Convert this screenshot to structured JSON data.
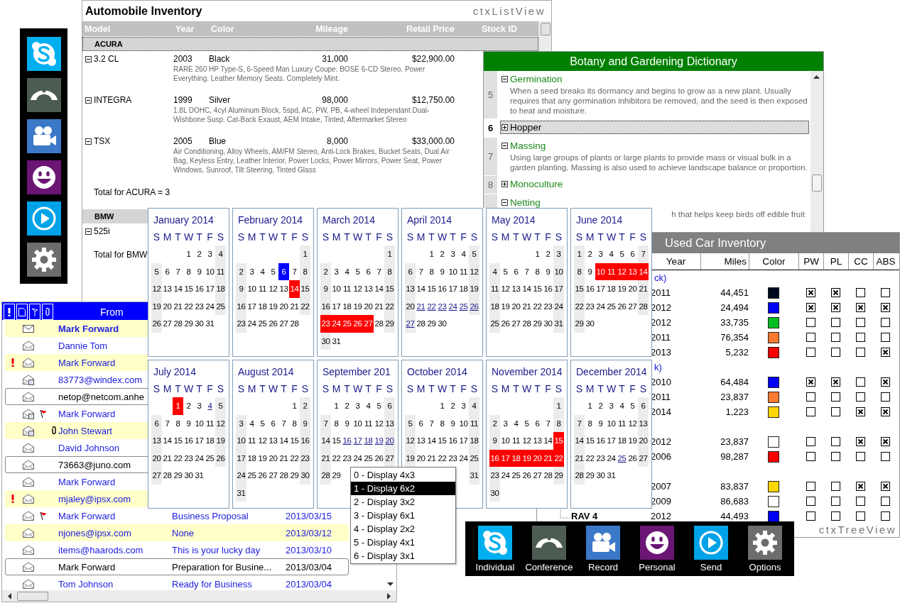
{
  "inventory": {
    "title": "Automobile Inventory",
    "brand": "ctxListView",
    "columns": [
      "Model",
      "Year",
      "Color",
      "Mileage",
      "Retail Price",
      "Stock ID"
    ],
    "groups": [
      {
        "name": "ACURA",
        "selected": true,
        "cars": [
          {
            "model": "3.2 CL",
            "expanded": true,
            "year": "2003",
            "exterior": "Black",
            "mileage": "31,000",
            "price": "$22,900.00",
            "notes": "RARE 260 HP Type-S, 6-Speed Man Luxury Coupe. BOSE 6-CD Stereo. Power Everything. Leather Memory Seats. Completely Mint."
          },
          {
            "model": "INTEGRA",
            "expanded": true,
            "year": "1999",
            "exterior": "Silver",
            "mileage": "98,000",
            "price": "$12,750.00",
            "notes": "1.8L DOHC, 4cyl Aluminum Block, 5spd, AC, PW, PB, 4-wheel Independant Dual-Wishbone Susp. Cat-Back Exaust, AEM Intake, Tinted, Aftermarket Stereo"
          },
          {
            "model": "TSX",
            "expanded": true,
            "year": "2005",
            "exterior": "Blue",
            "mileage": "8,000",
            "price": "$33,000.00",
            "notes": "Air Conditioning, Alloy Wheels, AM/FM Stereo, Anti-Lock Brakes, Bucket Seats, Dual Air Bag, Keyless Entry, Leather Interior, Power Locks, Power Mirrors, Power Seat, Power Windows, Sunroof, Tilt Steering, Tinted Glass"
          }
        ],
        "total": "Total for ACURA = 3"
      },
      {
        "name": "BMW",
        "selected": false,
        "cars": [
          {
            "model": "525i",
            "expanded": true
          }
        ],
        "total": "Total for BMW"
      }
    ]
  },
  "botany": {
    "title": "Botany and Gardening Dictionary",
    "entries": [
      {
        "number": "5",
        "expanded": true,
        "selected": false,
        "term": "Germination",
        "definition": "When a seed breaks its dormancy and begins to grow as a new plant. Usually requires that any germination inhibitors be removed, and the seed is then exposed to heat and moisture."
      },
      {
        "number": "6",
        "expanded": false,
        "selected": true,
        "term": "Hopper"
      },
      {
        "number": "7",
        "expanded": true,
        "selected": false,
        "term": "Massing",
        "definition": "Using large groups of plants or large plants to provide mass or visual bulk in a garden planting. Massing is also used to achieve landscape balance or proportion."
      },
      {
        "number": "8",
        "expanded": false,
        "selected": false,
        "term": "Monoculture"
      },
      {
        "expanded": true,
        "selected": false,
        "term": "Netting",
        "definition": "h that helps keep birds off edible fruit",
        "definition_cut": true
      }
    ]
  },
  "used_cars": {
    "title": "Used Car Inventory",
    "brand": "ctxTreeView",
    "columns": [
      "Year",
      "Miles",
      "Color",
      "PW",
      "PL",
      "CC",
      "ABS"
    ],
    "rows": [
      {
        "kind": "group",
        "label": "ck)"
      },
      {
        "kind": "car",
        "year": "2011",
        "miles": "44,451",
        "color": "#000a1e",
        "features": [
          true,
          true,
          false,
          false
        ]
      },
      {
        "kind": "car",
        "year": "2012",
        "miles": "24,494",
        "color": "#0000ff",
        "features": [
          true,
          true,
          true,
          true
        ]
      },
      {
        "kind": "car",
        "year": "2012",
        "miles": "33,735",
        "color": "#00c020",
        "features": [
          false,
          false,
          false,
          false
        ]
      },
      {
        "kind": "car",
        "year": "2011",
        "miles": "76,354",
        "color": "#f97a30",
        "features": [
          false,
          false,
          false,
          false
        ]
      },
      {
        "kind": "car",
        "year": "2013",
        "miles": "5,232",
        "color": "#ff0000",
        "features": [
          false,
          false,
          false,
          true
        ]
      },
      {
        "kind": "group",
        "label": "k)"
      },
      {
        "kind": "car",
        "year": "2010",
        "miles": "64,484",
        "color": "#0000ff",
        "features": [
          true,
          true,
          false,
          true
        ]
      },
      {
        "kind": "car",
        "year": "2011",
        "miles": "23,837",
        "color": "#f97a30",
        "features": [
          false,
          false,
          false,
          false
        ]
      },
      {
        "kind": "car",
        "year": "2014",
        "miles": "1,223",
        "color": "#ffd700",
        "features": [
          false,
          false,
          true,
          true
        ]
      },
      {
        "kind": "group"
      },
      {
        "kind": "car",
        "year": "2012",
        "miles": "23,837",
        "color": "#ffffff",
        "features": [
          false,
          false,
          true,
          true
        ]
      },
      {
        "kind": "car",
        "year": "2006",
        "miles": "98,287",
        "color": "#ff0000",
        "features": [
          false,
          false,
          false,
          false
        ]
      },
      {
        "kind": "group"
      },
      {
        "kind": "car",
        "year": "2007",
        "miles": "83,837",
        "color": "#ffd700",
        "features": [
          false,
          false,
          true,
          true
        ]
      },
      {
        "kind": "car",
        "year": "2009",
        "miles": "86,683",
        "color": "#ffffff",
        "features": [
          false,
          false,
          false,
          false
        ]
      },
      {
        "kind": "car",
        "model": "RAV 4",
        "year": "2012",
        "miles": "44,493",
        "color": "#0000ff",
        "features": [
          false,
          false,
          false,
          false
        ]
      }
    ]
  },
  "side_toolbar": {
    "buttons": [
      {
        "kind": "chat"
      },
      {
        "kind": "conference"
      },
      {
        "kind": "record"
      },
      {
        "kind": "personal"
      },
      {
        "kind": "send"
      },
      {
        "kind": "options"
      }
    ]
  },
  "mail": {
    "from_header": "From",
    "rows": [
      {
        "from": "Mark Forward",
        "kind": "closed",
        "unread": true,
        "highlighted": true,
        "selected": false,
        "priority": false,
        "flagged": false,
        "attachment": false
      },
      {
        "from": "Dannie Tom",
        "kind": "open",
        "unread": false,
        "highlighted": false,
        "selected": false,
        "priority": false,
        "flagged": false,
        "attachment": false
      },
      {
        "from": "Mark Forward",
        "kind": "open",
        "unread": false,
        "highlighted": true,
        "selected": false,
        "priority": true,
        "flagged": false,
        "attachment": false
      },
      {
        "from": "83773@windex.com",
        "kind": "reply",
        "unread": false,
        "highlighted": false,
        "selected": false,
        "priority": false,
        "flagged": false,
        "attachment": false
      },
      {
        "from": "netop@netcom.anhe",
        "kind": "open",
        "unread": false,
        "highlighted": false,
        "selected": true,
        "priority": false,
        "flagged": false,
        "attachment": false
      },
      {
        "from": "Mark Forward",
        "kind": "reply",
        "unread": false,
        "highlighted": false,
        "selected": false,
        "priority": false,
        "flagged": true,
        "attachment": false
      },
      {
        "from": "John Stewart",
        "kind": "reply",
        "unread": false,
        "highlighted": true,
        "selected": false,
        "priority": false,
        "flagged": false,
        "attachment": true
      },
      {
        "from": "David Johnson",
        "kind": "open",
        "unread": false,
        "highlighted": false,
        "selected": false,
        "priority": false,
        "flagged": false,
        "attachment": false
      },
      {
        "from": "73663@juno.com",
        "kind": "open",
        "unread": false,
        "highlighted": false,
        "selected": true,
        "priority": false,
        "flagged": false,
        "attachment": false
      },
      {
        "from": "Mark Forward",
        "kind": "open",
        "unread": false,
        "highlighted": false,
        "selected": false,
        "priority": false,
        "flagged": false,
        "attachment": false
      },
      {
        "from": "mjaley@ipsx.com",
        "kind": "open",
        "unread": false,
        "highlighted": true,
        "selected": false,
        "priority": true,
        "flagged": false,
        "attachment": false
      },
      {
        "from": "Mark Forward",
        "subject": "Business Proposal",
        "date": "2013/03/15",
        "kind": "open",
        "unread": false,
        "highlighted": false,
        "selected": false,
        "priority": false,
        "flagged": true,
        "attachment": false
      },
      {
        "from": "njones@ipsx.com",
        "subject": "None",
        "date": "2013/03/12",
        "kind": "open",
        "unread": false,
        "highlighted": true,
        "selected": false,
        "priority": false,
        "flagged": false,
        "attachment": false
      },
      {
        "from": "items@haarods.com",
        "subject": "This is your lucky day",
        "date": "2013/03/10",
        "kind": "open",
        "unread": false,
        "highlighted": false,
        "selected": false,
        "priority": false,
        "flagged": false,
        "attachment": false
      },
      {
        "from": "Mark Forward",
        "subject": "Preparation for Busine...",
        "date": "2013/03/04",
        "kind": "open",
        "unread": false,
        "highlighted": false,
        "selected": true,
        "priority": false,
        "flagged": false,
        "attachment": false
      },
      {
        "from": "Tom Johnson",
        "subject": "Ready for Business",
        "date": "2013/03/04",
        "kind": "open",
        "unread": false,
        "highlighted": false,
        "selected": false,
        "priority": false,
        "flagged": false,
        "attachment": false
      }
    ]
  },
  "calendar": {
    "months": [
      {
        "title": "January 2014",
        "weekdays": [
          "S",
          "M",
          "T",
          "W",
          "T",
          "F",
          "S"
        ],
        "weeks": [
          {
            "kind": "leading",
            "days": [
              "1",
              "2",
              "3",
              "4"
            ]
          },
          {
            "days": [
              "5",
              "6",
              "7",
              "8",
              "9",
              "10",
              "11"
            ]
          },
          {
            "days": [
              "12",
              "13",
              "14",
              "15",
              "16",
              "17",
              "18"
            ]
          },
          {
            "days": [
              "19",
              "20",
              "21",
              "22",
              "23",
              "24",
              "25"
            ]
          },
          {
            "days": [
              "26",
              "27",
              "28",
              "29",
              "30",
              "31"
            ]
          }
        ]
      },
      {
        "title": "February 2014",
        "weekdays": [
          "S",
          "M",
          "T",
          "W",
          "T",
          "F",
          "S"
        ],
        "weeks": [
          {
            "kind": "leading",
            "days": [
              "1"
            ]
          },
          {
            "days": [
              "2",
              "3",
              "4",
              "5",
              {
                "day": "6",
                "kind": "today"
              },
              "7",
              "8"
            ]
          },
          {
            "days": [
              "9",
              "10",
              "11",
              "12",
              "13",
              {
                "day": "14",
                "kind": "selected"
              },
              "15"
            ]
          },
          {
            "days": [
              "16",
              "17",
              "18",
              "19",
              "20",
              "21",
              "22"
            ]
          },
          {
            "days": [
              "23",
              "24",
              "25",
              "26",
              "27",
              "28"
            ]
          }
        ]
      },
      {
        "title": "March 2014",
        "weekdays": [
          "S",
          "M",
          "T",
          "W",
          "T",
          "F",
          "S"
        ],
        "weeks": [
          {
            "kind": "leading",
            "days": [
              "1"
            ]
          },
          {
            "days": [
              "2",
              "3",
              "4",
              "5",
              "6",
              "7",
              "8"
            ]
          },
          {
            "days": [
              "9",
              "10",
              "11",
              "12",
              "13",
              "14",
              "15"
            ]
          },
          {
            "days": [
              "16",
              "17",
              "18",
              "19",
              "20",
              "21",
              "22"
            ]
          },
          {
            "days": [
              {
                "day": "23",
                "kind": "selected"
              },
              {
                "day": "24",
                "kind": "selected"
              },
              {
                "day": "25",
                "kind": "selected"
              },
              {
                "day": "26",
                "kind": "selected"
              },
              {
                "day": "27",
                "kind": "selected"
              },
              "28",
              "29"
            ]
          },
          {
            "days": [
              "30",
              "31"
            ]
          }
        ]
      },
      {
        "title": "April 2014",
        "weekdays": [
          "S",
          "M",
          "T",
          "W",
          "T",
          "F",
          "S"
        ],
        "weeks": [
          {
            "kind": "leading",
            "days": [
              "1",
              "2",
              "3",
              "4",
              "5"
            ]
          },
          {
            "days": [
              "6",
              "7",
              "8",
              "9",
              "10",
              "11",
              "12"
            ]
          },
          {
            "days": [
              "13",
              "14",
              "15",
              "16",
              "17",
              "18",
              "19"
            ]
          },
          {
            "days": [
              "20",
              {
                "day": "21",
                "kind": "event"
              },
              {
                "day": "22",
                "kind": "event"
              },
              {
                "day": "23",
                "kind": "event"
              },
              {
                "day": "24",
                "kind": "event"
              },
              {
                "day": "25",
                "kind": "event"
              },
              {
                "day": "26",
                "kind": "event"
              }
            ]
          },
          {
            "days": [
              {
                "day": "27",
                "kind": "event"
              },
              "28",
              "29",
              "30"
            ]
          }
        ]
      },
      {
        "title": "May 2014",
        "weekdays": [
          "S",
          "M",
          "T",
          "W",
          "T",
          "F",
          "S"
        ],
        "weeks": [
          {
            "kind": "leading",
            "days": [
              "1",
              "2",
              "3"
            ]
          },
          {
            "days": [
              "4",
              "5",
              "6",
              "7",
              "8",
              "9",
              "10"
            ]
          },
          {
            "days": [
              "11",
              "12",
              "13",
              "14",
              "15",
              "16",
              "17"
            ]
          },
          {
            "days": [
              "18",
              "19",
              "20",
              "21",
              "22",
              "23",
              "24"
            ]
          },
          {
            "days": [
              "25",
              "26",
              "27",
              "28",
              "29",
              "30",
              "31"
            ]
          }
        ]
      },
      {
        "title": "June 2014",
        "weekdays": [
          "S",
          "M",
          "T",
          "W",
          "T",
          "F",
          "S"
        ],
        "weeks": [
          {
            "days": [
              "1",
              "2",
              "3",
              "4",
              "5",
              "6",
              "7"
            ]
          },
          {
            "days": [
              "8",
              "9",
              {
                "day": "10",
                "kind": "selected"
              },
              {
                "day": "11",
                "kind": "selected"
              },
              {
                "day": "12",
                "kind": "selected"
              },
              {
                "day": "13",
                "kind": "selected"
              },
              {
                "day": "14",
                "kind": "selected"
              }
            ]
          },
          {
            "days": [
              "15",
              "16",
              "17",
              "18",
              "19",
              "20",
              "21"
            ]
          },
          {
            "days": [
              "22",
              "23",
              "24",
              "25",
              "26",
              "27",
              "28"
            ]
          },
          {
            "days": [
              "29",
              "30"
            ]
          }
        ]
      },
      {
        "title": "July 2014",
        "weekdays": [
          "S",
          "M",
          "T",
          "W",
          "T",
          "F",
          "S"
        ],
        "weeks": [
          {
            "kind": "leading",
            "days": [
              {
                "day": "1",
                "kind": "selected"
              },
              "2",
              "3",
              {
                "day": "4",
                "kind": "event"
              },
              "5"
            ]
          },
          {
            "days": [
              "6",
              "7",
              "8",
              "9",
              "10",
              "11",
              "12"
            ]
          },
          {
            "days": [
              "13",
              "14",
              "15",
              "16",
              "17",
              "18",
              "19"
            ]
          },
          {
            "days": [
              "20",
              "21",
              "22",
              "23",
              "24",
              "25",
              "26"
            ]
          },
          {
            "days": [
              "27",
              "28",
              "29",
              "30",
              "31"
            ]
          }
        ]
      },
      {
        "title": "August 2014",
        "weekdays": [
          "S",
          "M",
          "T",
          "W",
          "T",
          "F",
          "S"
        ],
        "weeks": [
          {
            "kind": "leading",
            "days": [
              "1",
              "2"
            ]
          },
          {
            "days": [
              "3",
              "4",
              "5",
              "6",
              "7",
              "8",
              "9"
            ]
          },
          {
            "days": [
              "10",
              "11",
              "12",
              "13",
              "14",
              "15",
              "16"
            ]
          },
          {
            "days": [
              "17",
              "18",
              "19",
              "20",
              "21",
              "22",
              "23"
            ]
          },
          {
            "days": [
              "24",
              "25",
              "26",
              "27",
              "28",
              "29",
              "30"
            ]
          },
          {
            "days": [
              "31"
            ]
          }
        ]
      },
      {
        "title": "September 201",
        "weekdays": [
          "S",
          "M",
          "T",
          "W",
          "T",
          "F",
          "S"
        ],
        "weeks": [
          {
            "kind": "leading",
            "days": [
              "1",
              "2",
              "3",
              "4",
              "5",
              "6"
            ]
          },
          {
            "days": [
              "7",
              "8",
              "9",
              "10",
              "11",
              "12",
              "13"
            ]
          },
          {
            "days": [
              "14",
              "15",
              {
                "day": "16",
                "kind": "event"
              },
              {
                "day": "17",
                "kind": "event"
              },
              {
                "day": "18",
                "kind": "event"
              },
              {
                "day": "19",
                "kind": "event"
              },
              {
                "day": "20",
                "kind": "event"
              }
            ]
          },
          {
            "days": [
              "21",
              "22",
              "23",
              "24",
              "25",
              "26",
              "27"
            ]
          },
          {
            "days": [
              "28",
              "29"
            ]
          }
        ]
      },
      {
        "title": "October 2014",
        "weekdays": [
          "S",
          "M",
          "T",
          "W",
          "T",
          "F",
          "S"
        ],
        "weeks": [
          {
            "kind": "leading",
            "days": [
              "1",
              "2",
              "3",
              "4"
            ]
          },
          {
            "days": [
              "5",
              "6",
              "7",
              "8",
              "9",
              "10",
              "11"
            ]
          },
          {
            "days": [
              "12",
              "13",
              "14",
              "15",
              "16",
              "17",
              "18"
            ]
          },
          {
            "days": [
              "19",
              "20",
              "21",
              "22",
              "23",
              "24",
              "25"
            ]
          },
          {
            "kind": "leading",
            "days": [
              "31"
            ]
          }
        ]
      },
      {
        "title": "November 2014",
        "weekdays": [
          "S",
          "M",
          "T",
          "W",
          "T",
          "F",
          "S"
        ],
        "weeks": [
          {
            "kind": "leading",
            "days": [
              "1"
            ]
          },
          {
            "days": [
              "2",
              "3",
              "4",
              "5",
              "6",
              "7",
              "8"
            ]
          },
          {
            "days": [
              "9",
              "10",
              "11",
              "12",
              "13",
              "14",
              {
                "day": "15",
                "kind": "selected"
              }
            ]
          },
          {
            "days": [
              {
                "day": "16",
                "kind": "selected"
              },
              {
                "day": "17",
                "kind": "selected"
              },
              {
                "day": "18",
                "kind": "selected"
              },
              {
                "day": "19",
                "kind": "selected"
              },
              {
                "day": "20",
                "kind": "selected"
              },
              {
                "day": "21",
                "kind": "selected"
              },
              {
                "day": "22",
                "kind": "selected"
              }
            ]
          },
          {
            "days": [
              "23",
              "24",
              "25",
              "26",
              "27",
              "28",
              "29"
            ]
          },
          {
            "days": [
              "30"
            ]
          }
        ]
      },
      {
        "title": "December 2014",
        "weekdays": [
          "S",
          "M",
          "T",
          "W",
          "T",
          "F",
          "S"
        ],
        "weeks": [
          {
            "kind": "leading",
            "days": [
              "1",
              "2",
              "3",
              "4",
              "5",
              "6"
            ]
          },
          {
            "days": [
              "7",
              "8",
              "9",
              "10",
              "11",
              "12",
              "13"
            ]
          },
          {
            "days": [
              "14",
              "15",
              "16",
              "17",
              "18",
              "19",
              "20"
            ]
          },
          {
            "days": [
              "21",
              "22",
              "23",
              "24",
              {
                "day": "25",
                "kind": "event"
              },
              "26",
              "27"
            ]
          },
          {
            "days": [
              "28",
              "29",
              "30",
              "31"
            ]
          }
        ]
      }
    ]
  },
  "layout_menu": {
    "items": [
      {
        "label": "0 - Display 4x3",
        "selected": false
      },
      {
        "label": "1 - Display 6x2",
        "selected": true
      },
      {
        "label": "2 - Display 3x2",
        "selected": false
      },
      {
        "label": "3 - Display 6x1",
        "selected": false
      },
      {
        "label": "4 - Display 2x2",
        "selected": false
      },
      {
        "label": "5 - Display 4x1",
        "selected": false
      },
      {
        "label": "6 - Display 3x1",
        "selected": false
      }
    ]
  },
  "bottom_toolbar": {
    "buttons": [
      {
        "kind": "chat",
        "label": "Individual"
      },
      {
        "kind": "conference",
        "label": "Conference"
      },
      {
        "kind": "record",
        "label": "Record"
      },
      {
        "kind": "personal",
        "label": "Personal"
      },
      {
        "kind": "send",
        "label": "Send"
      },
      {
        "kind": "options",
        "label": "Options"
      }
    ]
  }
}
